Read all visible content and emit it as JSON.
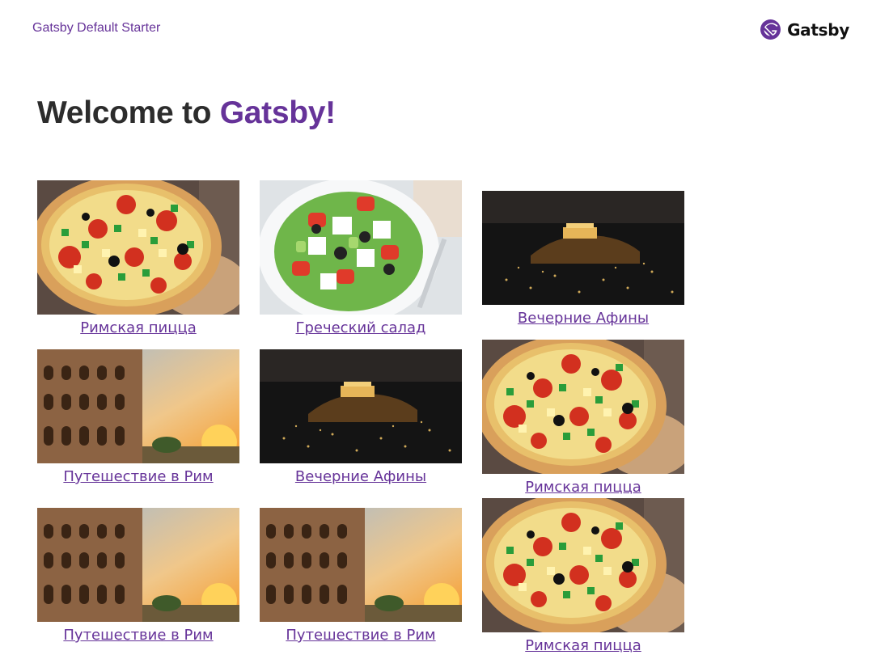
{
  "header": {
    "site_title": "Gatsby Default Starter",
    "brand_text": "Gatsby"
  },
  "main": {
    "headline_prefix": "Welcome to",
    "headline_accent": "Gatsby!"
  },
  "colors": {
    "brand_purple": "#663399",
    "text_dark": "#2c2c2c"
  },
  "cards": [
    {
      "caption": "Римская пицца",
      "image": "pizza"
    },
    {
      "caption": "Греческий салад",
      "image": "greek-salad"
    },
    {
      "caption": "Вечерние Афины",
      "image": "athens-night"
    },
    {
      "caption": "Путешествие в Рим",
      "image": "colosseum"
    },
    {
      "caption": "Вечерние Афины",
      "image": "athens-night"
    },
    {
      "caption": "Римская пицца",
      "image": "pizza"
    },
    {
      "caption": "Путешествие в Рим",
      "image": "colosseum"
    },
    {
      "caption": "Путешествие в Рим",
      "image": "colosseum"
    },
    {
      "caption": "Римская пицца",
      "image": "pizza"
    }
  ]
}
